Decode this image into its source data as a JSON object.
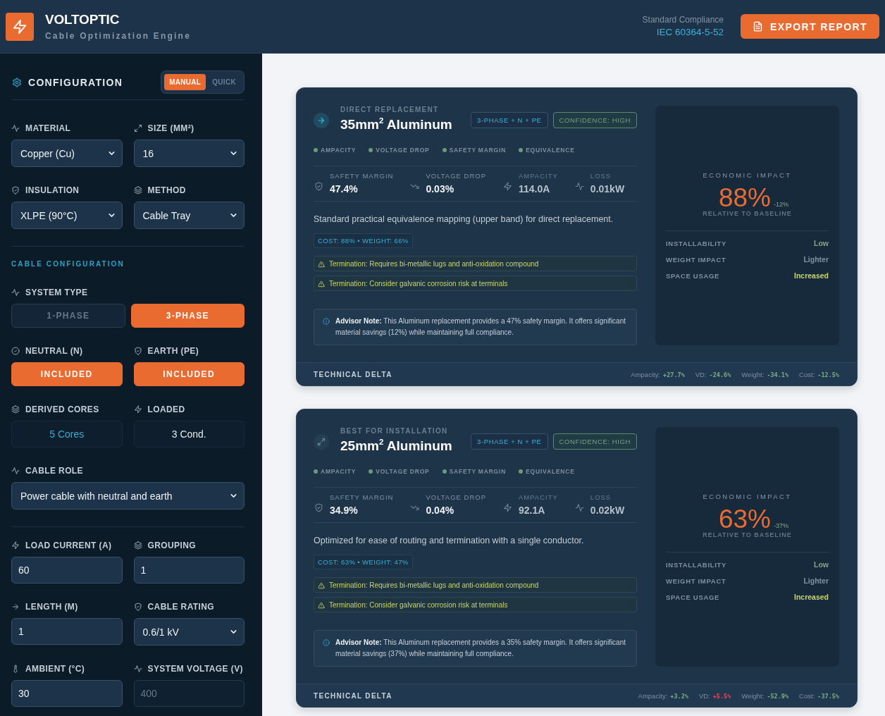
{
  "header": {
    "logo_title": "VOLTOPTIC",
    "subtitle": "Cable Optimization Engine",
    "compliance_label": "Standard Compliance",
    "compliance_value": "IEC 60364-5-52",
    "export_button": "EXPORT REPORT"
  },
  "sidebar": {
    "title": "CONFIGURATION",
    "modes": [
      {
        "label": "MANUAL",
        "selected": true
      },
      {
        "label": "QUICK",
        "selected": false
      }
    ],
    "groups": [
      {
        "rows": [
          [
            {
              "kind": "select",
              "label": "MATERIAL",
              "value": "Copper (Cu)",
              "disabled": false
            },
            {
              "kind": "select",
              "label": "SIZE (MM²)",
              "value": "16",
              "disabled": false
            }
          ],
          [
            {
              "kind": "select",
              "label": "INSULATION",
              "value": "XLPE (90°C)",
              "disabled": false
            },
            {
              "kind": "select",
              "label": "METHOD",
              "value": "Cable Tray",
              "disabled": false
            }
          ]
        ]
      },
      {
        "heading": "CABLE CONFIGURATION",
        "rows": [
          [
            {
              "kind": "segmented",
              "label": "SYSTEM TYPE",
              "options": [
                {
                  "label": "1-PHASE",
                  "selected": false
                },
                {
                  "label": "3-PHASE",
                  "selected": true
                }
              ]
            }
          ],
          [
            {
              "kind": "toggle",
              "label": "NEUTRAL (N)",
              "value": "INCLUDED",
              "on": true
            },
            {
              "kind": "toggle",
              "label": "EARTH (PE)",
              "value": "INCLUDED",
              "on": true
            }
          ],
          [
            {
              "kind": "readout",
              "label": "DERIVED CORES",
              "value": "5 Cores",
              "accent": true
            },
            {
              "kind": "readout",
              "label": "LOADED",
              "value": "3 Cond.",
              "accent": false
            }
          ],
          [
            {
              "kind": "select",
              "label": "CABLE ROLE",
              "value": "Power cable with neutral and earth",
              "disabled": false
            }
          ]
        ]
      },
      {
        "rows": [
          [
            {
              "kind": "input",
              "label": "LOAD CURRENT (A)",
              "value": "60",
              "disabled": false
            },
            {
              "kind": "input",
              "label": "GROUPING",
              "value": "1",
              "disabled": false
            }
          ],
          [
            {
              "kind": "input",
              "label": "LENGTH (M)",
              "value": "1",
              "disabled": false
            },
            {
              "kind": "select",
              "label": "CABLE RATING",
              "value": "0.6/1 kV",
              "disabled": false
            }
          ],
          [
            {
              "kind": "input",
              "label": "AMBIENT (°C)",
              "value": "30",
              "disabled": false
            },
            {
              "kind": "input",
              "label": "SYSTEM VOLTAGE (V)",
              "value": "400",
              "disabled": true
            }
          ]
        ]
      }
    ]
  },
  "results": [
    {
      "category": "DIRECT REPLACEMENT",
      "title": "35mm$^{2}$ Aluminum",
      "badges": [
        {
          "kind": "phase",
          "label": "3-PHASE + N + PE"
        },
        {
          "kind": "confidence",
          "label": "CONFIDENCE: HIGH"
        }
      ],
      "checks": [
        {
          "label": "AMPACITY",
          "passed": true
        },
        {
          "label": "VOLTAGE DROP",
          "passed": true
        },
        {
          "label": "SAFETY MARGIN",
          "passed": true
        },
        {
          "label": "EQUIVALENCE",
          "passed": true
        }
      ],
      "metrics": [
        {
          "label": "SAFETY MARGIN",
          "value": "47.4%",
          "dimmed": false
        },
        {
          "label": "VOLTAGE DROP",
          "value": "0.03%",
          "dimmed": false
        },
        {
          "label": "AMPACITY",
          "value": "114.0A",
          "dimmed": true
        },
        {
          "label": "LOSS",
          "value": "0.01kW",
          "dimmed": true
        }
      ],
      "description": "Standard practical equivalence mapping (upper band) for direct replacement.",
      "cost_weight": "COST: 88% • WEIGHT: 66%",
      "warnings": [
        "Termination: Requires bi-metallic lugs and anti-oxidation compound",
        "Termination: Consider galvanic corrosion risk at terminals"
      ],
      "advisor_note": "**Advisor Note:** This Aluminum replacement provides a 47% safety margin. It offers significant material savings (12%) while maintaining full compliance.",
      "economic": {
        "title": "ECONOMIC IMPACT",
        "value": "88%",
        "change": "-12%",
        "caption": "RELATIVE TO BASELINE",
        "rows": [
          {
            "label": "INSTALLABILITY",
            "value": "Low",
            "color": "#87a18c"
          },
          {
            "label": "WEIGHT IMPACT",
            "value": "Lighter",
            "color": "#7f93a6"
          },
          {
            "label": "SPACE USAGE",
            "value": "Increased",
            "color": "#c8d46b"
          }
        ]
      },
      "delta": {
        "title": "TECHNICAL DELTA",
        "items": [
          {
            "label": "Ampacity:",
            "value": "+27.7%",
            "color": "#7dab87"
          },
          {
            "label": "VD:",
            "value": "-24.6%",
            "color": "#7dab87"
          },
          {
            "label": "Weight:",
            "value": "-34.1%",
            "color": "#7dab87"
          },
          {
            "label": "Cost:",
            "value": "-12.5%",
            "color": "#7dab87"
          }
        ]
      }
    },
    {
      "category": "BEST FOR INSTALLATION",
      "title": "25mm$^{2}$ Aluminum",
      "badges": [
        {
          "kind": "phase",
          "label": "3-PHASE + N + PE"
        },
        {
          "kind": "confidence",
          "label": "CONFIDENCE: HIGH"
        }
      ],
      "checks": [
        {
          "label": "AMPACITY",
          "passed": true
        },
        {
          "label": "VOLTAGE DROP",
          "passed": true
        },
        {
          "label": "SAFETY MARGIN",
          "passed": true
        },
        {
          "label": "EQUIVALENCE",
          "passed": true
        }
      ],
      "metrics": [
        {
          "label": "SAFETY MARGIN",
          "value": "34.9%",
          "dimmed": false
        },
        {
          "label": "VOLTAGE DROP",
          "value": "0.04%",
          "dimmed": false
        },
        {
          "label": "AMPACITY",
          "value": "92.1A",
          "dimmed": true
        },
        {
          "label": "LOSS",
          "value": "0.02kW",
          "dimmed": true
        }
      ],
      "description": "Optimized for ease of routing and termination with a single conductor.",
      "cost_weight": "COST: 63% • WEIGHT: 47%",
      "warnings": [
        "Termination: Requires bi-metallic lugs and anti-oxidation compound",
        "Termination: Consider galvanic corrosion risk at terminals"
      ],
      "advisor_note": "**Advisor Note:** This Aluminum replacement provides a 35% safety margin. It offers significant material savings (37%) while maintaining full compliance.",
      "economic": {
        "title": "ECONOMIC IMPACT",
        "value": "63%",
        "change": "-37%",
        "caption": "RELATIVE TO BASELINE",
        "rows": [
          {
            "label": "INSTALLABILITY",
            "value": "Low",
            "color": "#87a18c"
          },
          {
            "label": "WEIGHT IMPACT",
            "value": "Lighter",
            "color": "#7f93a6"
          },
          {
            "label": "SPACE USAGE",
            "value": "Increased",
            "color": "#c8d46b"
          }
        ]
      },
      "delta": {
        "title": "TECHNICAL DELTA",
        "items": [
          {
            "label": "Ampacity:",
            "value": "+3.2%",
            "color": "#7dab87"
          },
          {
            "label": "VD:",
            "value": "+5.5%",
            "color": "#e5485c"
          },
          {
            "label": "Weight:",
            "value": "-52.9%",
            "color": "#7dab87"
          },
          {
            "label": "Cost:",
            "value": "-37.5%",
            "color": "#7dab87"
          }
        ]
      }
    }
  ]
}
